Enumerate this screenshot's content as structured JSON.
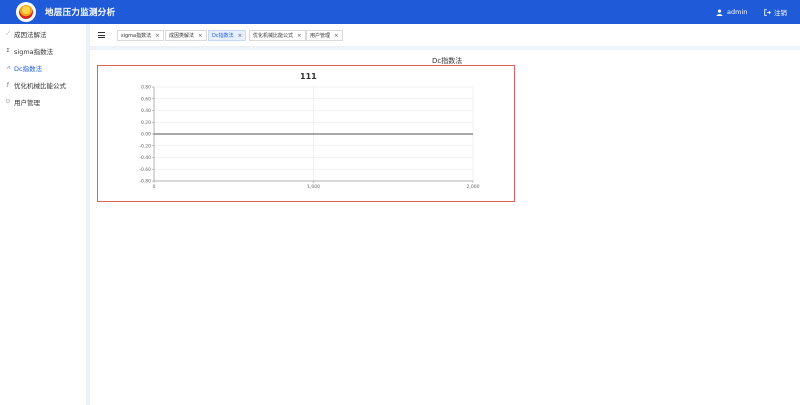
{
  "header": {
    "app_title": "地层压力监测分析",
    "user_name": "admin",
    "logout_label": "注销",
    "bg_color": "#1f5ad8"
  },
  "sidebar": {
    "items": [
      {
        "label": "成因法解法",
        "icon": "trend-icon",
        "active": false
      },
      {
        "label": "sigma指数法",
        "icon": "sigma-icon",
        "active": false
      },
      {
        "label": "Dc指数法",
        "icon": "chart-icon",
        "active": true
      },
      {
        "label": "优化机械比能公式",
        "icon": "function-icon",
        "active": false
      },
      {
        "label": "用户管理",
        "icon": "user-icon",
        "active": false
      }
    ]
  },
  "tabs": [
    {
      "label": "sigma指数法",
      "active": false
    },
    {
      "label": "成因类解法",
      "active": false
    },
    {
      "label": "Dc指数法",
      "active": true
    },
    {
      "label": "优化机械比能公式",
      "active": false
    },
    {
      "label": "用户管理",
      "active": false
    }
  ],
  "panel": {
    "title": "Dc指数法"
  },
  "chart_data": {
    "type": "line",
    "title": "111",
    "x_ticks": [
      "0",
      "1,000",
      "2,000"
    ],
    "x_values": [
      0,
      1000,
      2000
    ],
    "xlim": [
      0,
      2000
    ],
    "y_ticks": [
      "0.80",
      "0.60",
      "0.40",
      "0.20",
      "0.00",
      "-0.20",
      "-0.40",
      "-0.60",
      "-0.80"
    ],
    "y_values": [
      0.8,
      0.6,
      0.4,
      0.2,
      0.0,
      -0.2,
      -0.4,
      -0.6,
      -0.8
    ],
    "ylim": [
      -0.8,
      0.8
    ],
    "grid": true,
    "series": [
      {
        "x": [
          0,
          2000
        ],
        "y": [
          0,
          0
        ],
        "color": "#555555"
      }
    ]
  }
}
